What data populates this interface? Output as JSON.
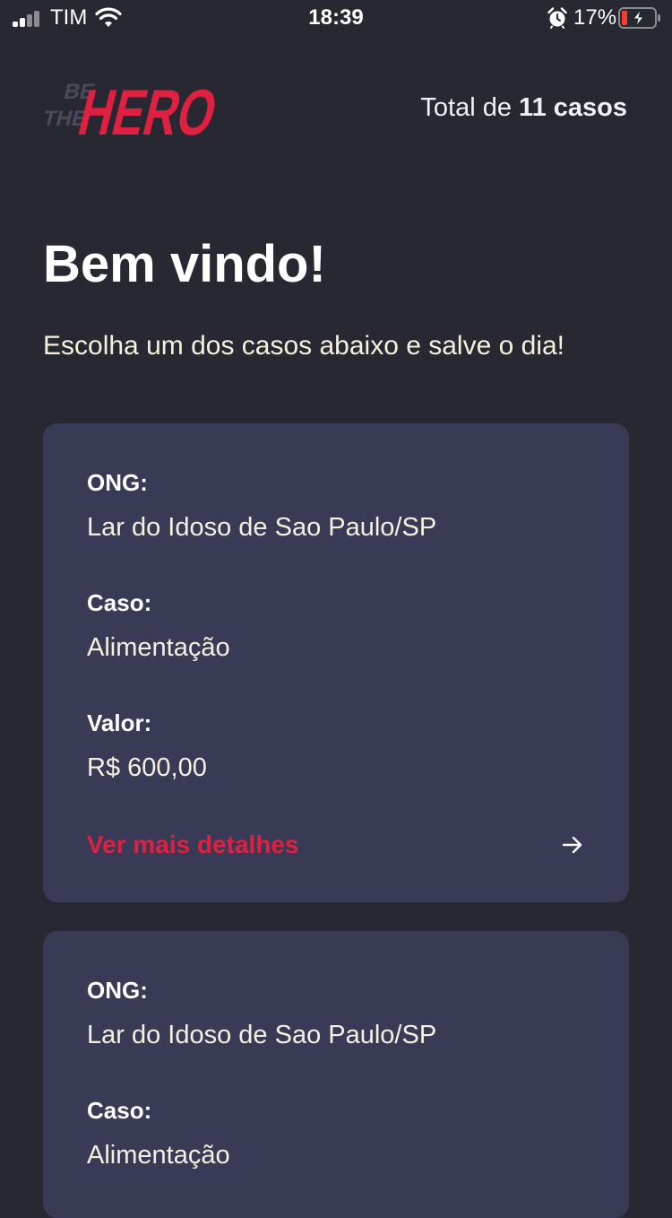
{
  "status_bar": {
    "carrier": "TIM",
    "time": "18:39",
    "battery_percent": "17%",
    "battery_level": 0.17,
    "icons": [
      "signal-icon",
      "wifi-icon",
      "alarm-icon",
      "battery-icon"
    ]
  },
  "header": {
    "logo_alt": "BE THE HERO",
    "total_prefix": "Total de ",
    "total_count": "11 casos"
  },
  "main": {
    "title": "Bem vindo!",
    "description": "Escolha um dos casos abaixo e salve o dia!"
  },
  "labels": {
    "ong": "ONG:",
    "case": "Caso:",
    "value": "Valor:",
    "details": "Ver mais detalhes"
  },
  "incidents": [
    {
      "ong": "Lar do Idoso de Sao Paulo/SP",
      "case": "Alimentação",
      "value": "R$ 600,00"
    },
    {
      "ong": "Lar do Idoso de Sao Paulo/SP",
      "case": "Alimentação"
    }
  ],
  "colors": {
    "background": "#282833",
    "card": "#393a56",
    "accent": "#e02041",
    "text_cream": "#f5f0e0"
  }
}
